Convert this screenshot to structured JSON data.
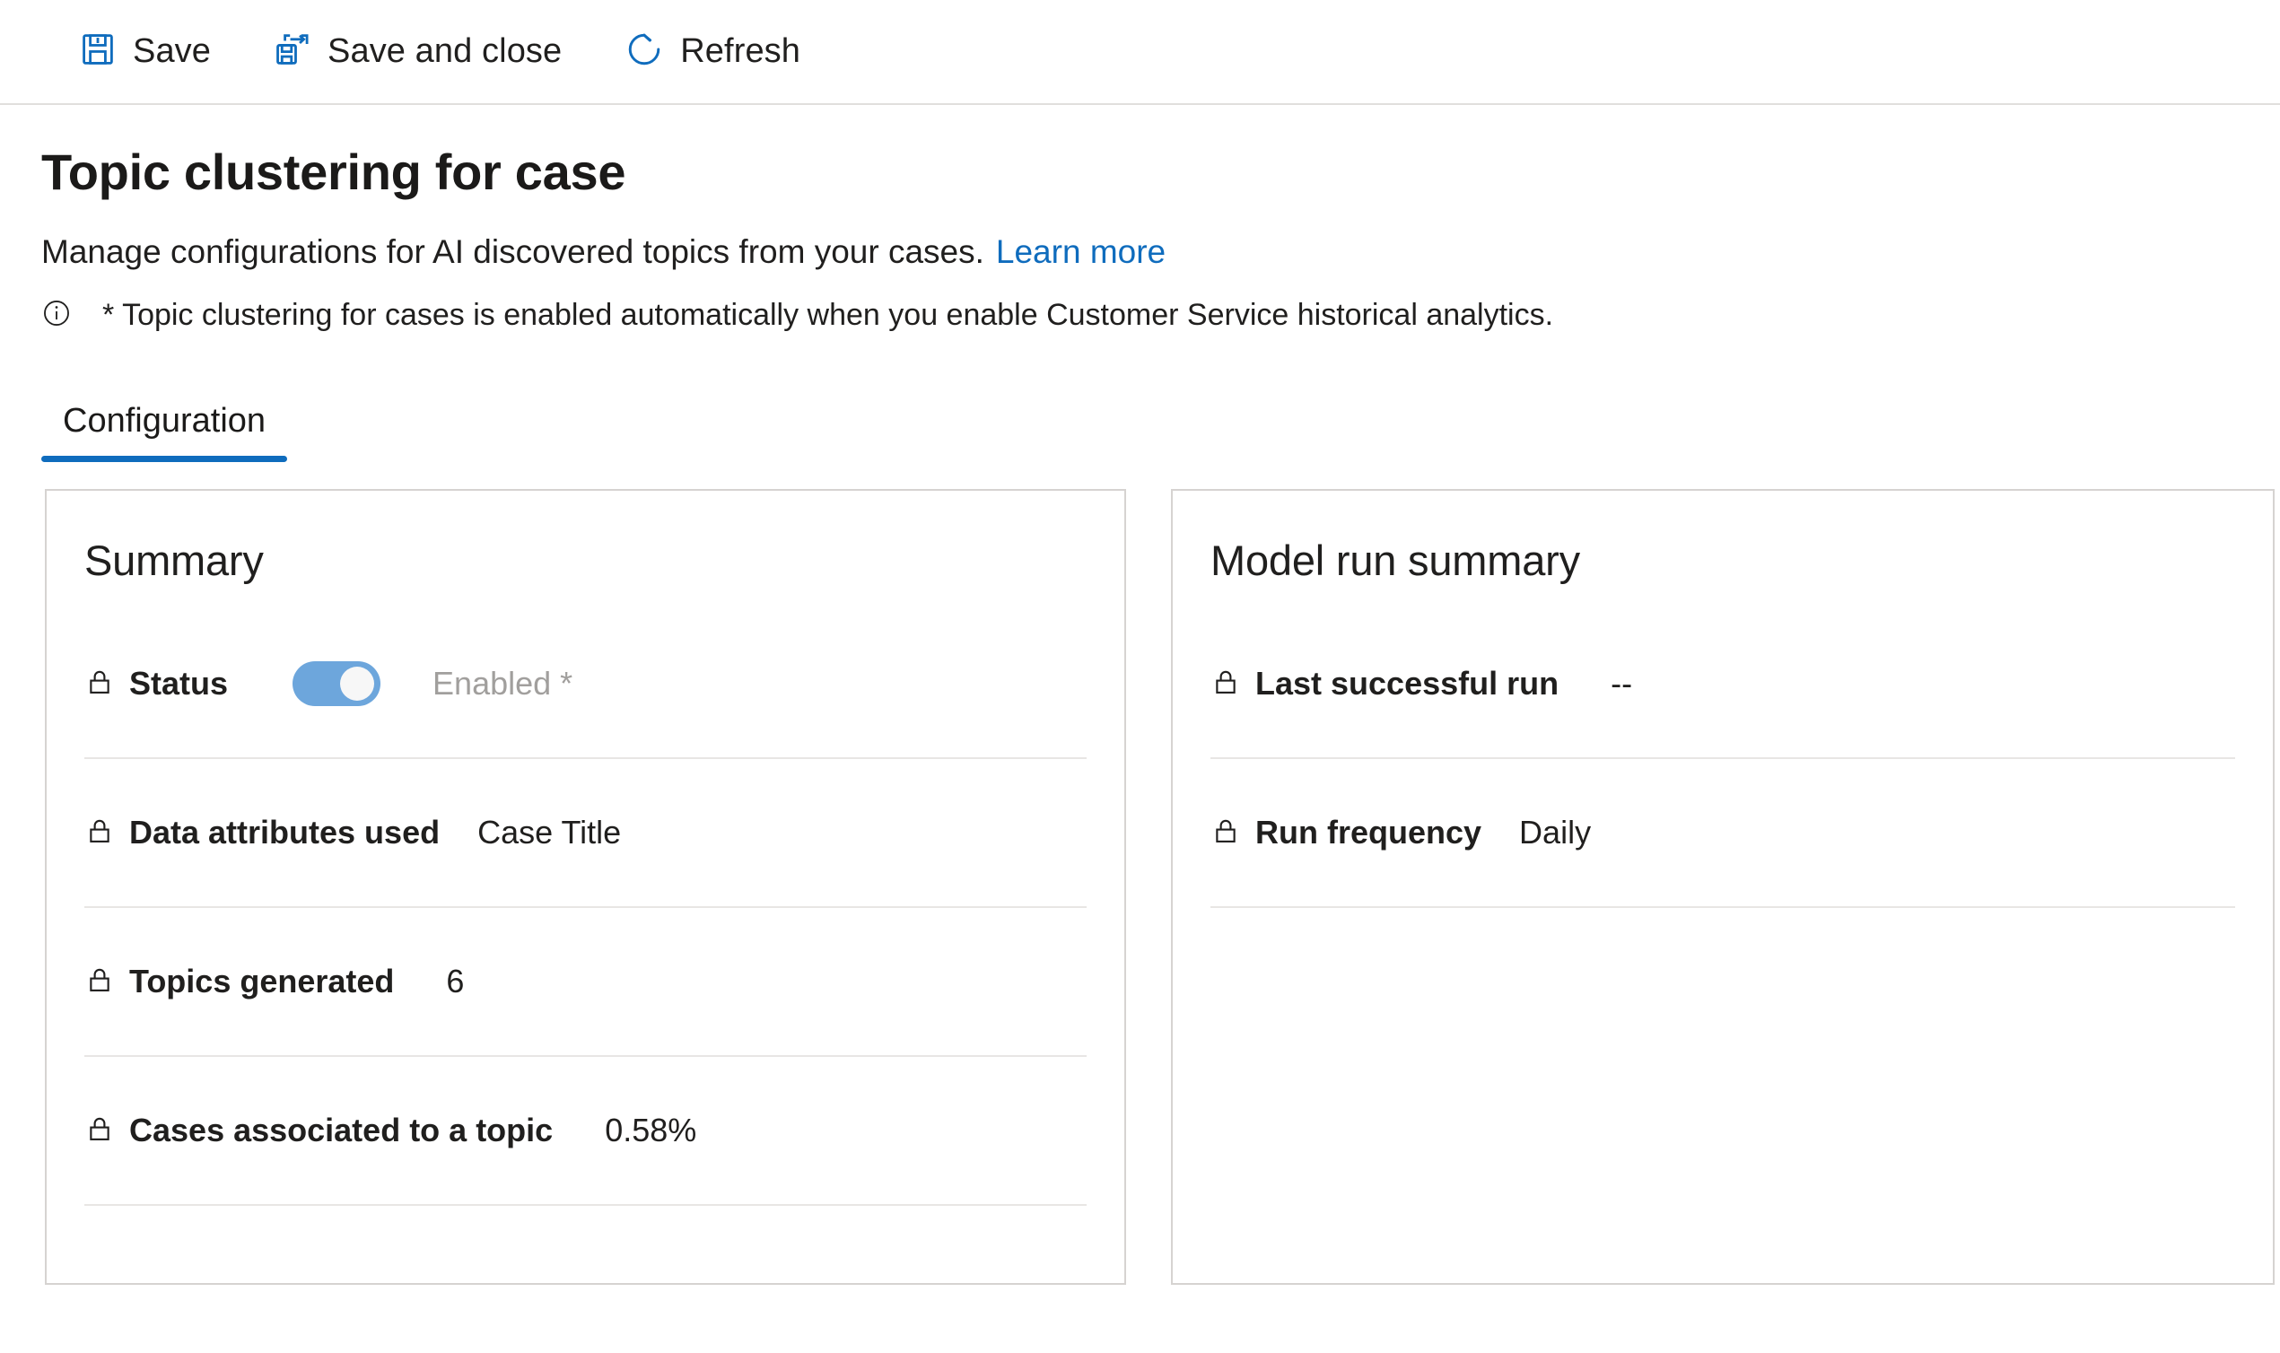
{
  "commandbar": {
    "buttons": [
      {
        "label": "Save",
        "icon": "save-icon"
      },
      {
        "label": "Save and close",
        "icon": "save-and-close-icon"
      },
      {
        "label": "Refresh",
        "icon": "refresh-icon"
      }
    ]
  },
  "header": {
    "title": "Topic clustering for case",
    "subtitle": "Manage configurations for AI discovered topics from your cases.",
    "learn_more": "Learn more",
    "note_icon": "info-icon",
    "note": "* Topic clustering for cases is enabled automatically when you enable Customer Service historical analytics."
  },
  "tabs": [
    {
      "label": "Configuration",
      "active": true
    }
  ],
  "summary_card": {
    "title": "Summary",
    "rows": [
      {
        "icon": "lock-icon",
        "label": "Status",
        "control": "toggle",
        "toggle_on": true,
        "value": "Enabled *"
      },
      {
        "icon": "lock-icon",
        "label": "Data attributes used",
        "value": "Case Title"
      },
      {
        "icon": "lock-icon",
        "label": "Topics generated",
        "value": "6"
      },
      {
        "icon": "lock-icon",
        "label": "Cases associated to a topic",
        "value": "0.58%"
      }
    ]
  },
  "model_run_card": {
    "title": "Model run summary",
    "rows": [
      {
        "icon": "lock-icon",
        "label": "Last successful run",
        "value": "--"
      },
      {
        "icon": "lock-icon",
        "label": "Run frequency",
        "value": "Daily"
      }
    ]
  },
  "colors": {
    "accent": "#0f6cbd",
    "toggle_on": "#6da6dc",
    "card_border": "#d6d3d1",
    "divider": "#e8e6e4",
    "muted_text": "#a19f9d"
  }
}
